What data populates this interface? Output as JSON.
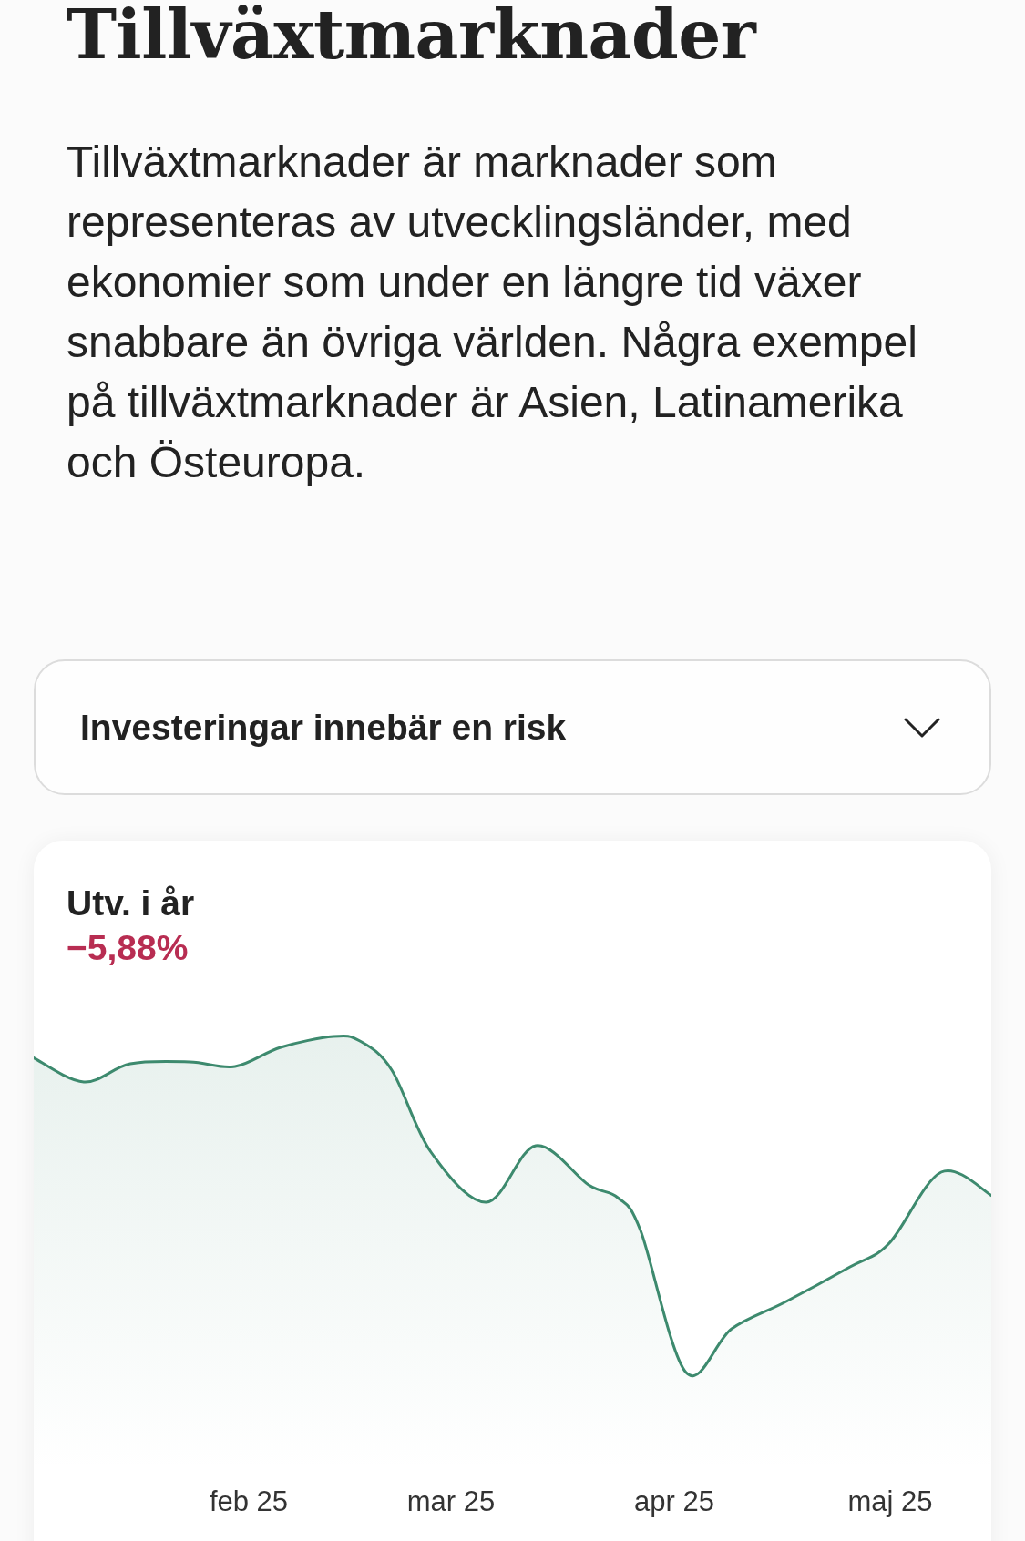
{
  "heading": "Tillväxtmarknader",
  "description": "Tillväxtmarknader är marknader som representeras av utvecklingsländer, med ekonomier som under en längre tid växer snabbare än övriga världen. Några exempel på tillväxtmarknader är Asien, Latinamerika och Östeuropa.",
  "disclosure": {
    "label": "Investeringar innebär en risk",
    "expanded": false
  },
  "performance_card": {
    "label": "Utv. i år",
    "value": "−5,88%",
    "negative": true,
    "x_labels": [
      "feb 25",
      "mar 25",
      "apr 25",
      "maj 25"
    ]
  }
}
